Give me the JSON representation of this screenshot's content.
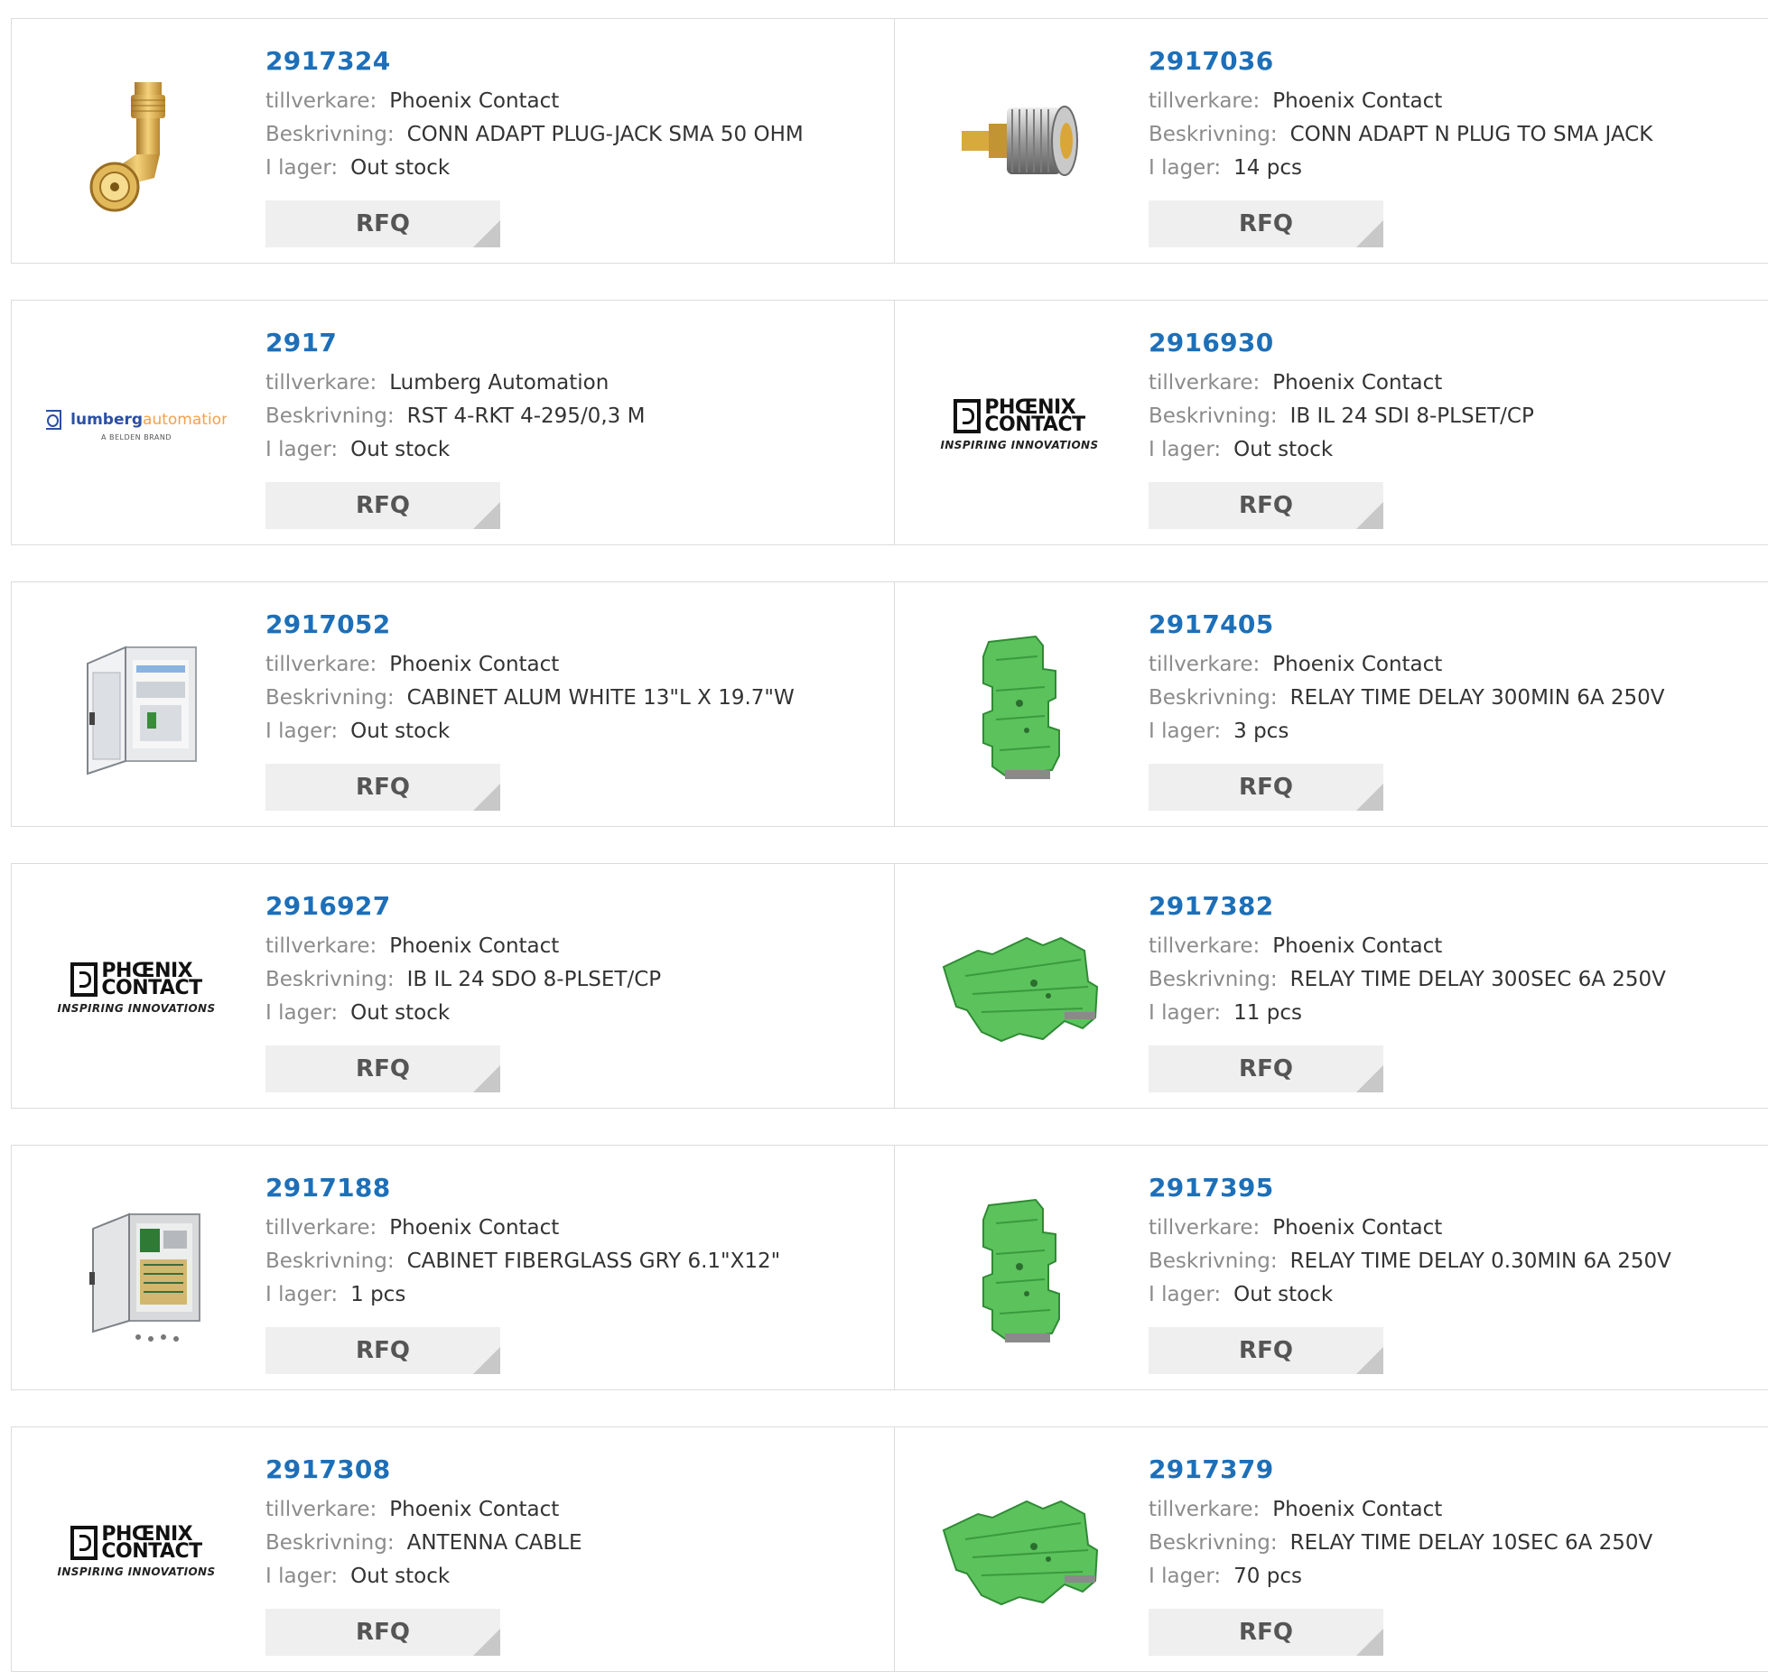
{
  "colors": {
    "part_number": "#1d6fb8",
    "label": "#8b8b8b",
    "value": "#333333",
    "button_bg": "#efefef",
    "border": "#dcdcdc"
  },
  "labels": {
    "manufacturer": "tillverkare:",
    "description": "Beskrivning:",
    "stock": "I lager:",
    "rfq": "RFQ"
  },
  "products": [
    {
      "pn": "2917324",
      "manufacturer": "Phoenix Contact",
      "description": "CONN ADAPT PLUG-JACK SMA 50 OHM",
      "stock": "Out stock",
      "image": "sma-right-angle-adapter"
    },
    {
      "pn": "2917036",
      "manufacturer": "Phoenix Contact",
      "description": "CONN ADAPT N PLUG TO SMA JACK",
      "stock": "14 pcs",
      "image": "n-to-sma-adapter"
    },
    {
      "pn": "2917",
      "manufacturer": "Lumberg Automation",
      "description": "RST 4-RKT 4-295/0,3 M",
      "stock": "Out stock",
      "image": "lumberg-logo",
      "logo": {
        "brand": "lumberg",
        "automation": "automation",
        "sub": "A BELDEN BRAND"
      }
    },
    {
      "pn": "2916930",
      "manufacturer": "Phoenix Contact",
      "description": "IB IL 24 SDI 8-PLSET/CP",
      "stock": "Out stock",
      "image": "phoenix-contact-logo",
      "logo": {
        "line1": "PHŒNIX",
        "line2": "CONTACT",
        "tag": "INSPIRING INNOVATIONS"
      }
    },
    {
      "pn": "2917052",
      "manufacturer": "Phoenix Contact",
      "description": "CABINET ALUM WHITE 13\"L X 19.7\"W",
      "stock": "Out stock",
      "image": "white-cabinet"
    },
    {
      "pn": "2917405",
      "manufacturer": "Phoenix Contact",
      "description": "RELAY TIME DELAY 300MIN 6A 250V",
      "stock": "3 pcs",
      "image": "green-relay-upright"
    },
    {
      "pn": "2916927",
      "manufacturer": "Phoenix Contact",
      "description": "IB IL 24 SDO 8-PLSET/CP",
      "stock": "Out stock",
      "image": "phoenix-contact-logo",
      "logo": {
        "line1": "PHŒNIX",
        "line2": "CONTACT",
        "tag": "INSPIRING INNOVATIONS"
      }
    },
    {
      "pn": "2917382",
      "manufacturer": "Phoenix Contact",
      "description": "RELAY TIME DELAY 300SEC 6A 250V",
      "stock": "11 pcs",
      "image": "green-relay-flat"
    },
    {
      "pn": "2917188",
      "manufacturer": "Phoenix Contact",
      "description": "CABINET FIBERGLASS GRY 6.1\"X12\"",
      "stock": "1 pcs",
      "image": "grey-cabinet"
    },
    {
      "pn": "2917395",
      "manufacturer": "Phoenix Contact",
      "description": "RELAY TIME DELAY 0.30MIN 6A 250V",
      "stock": "Out stock",
      "image": "green-relay-upright"
    },
    {
      "pn": "2917308",
      "manufacturer": "Phoenix Contact",
      "description": "ANTENNA CABLE",
      "stock": "Out stock",
      "image": "phoenix-contact-logo",
      "logo": {
        "line1": "PHŒNIX",
        "line2": "CONTACT",
        "tag": "INSPIRING INNOVATIONS"
      }
    },
    {
      "pn": "2917379",
      "manufacturer": "Phoenix Contact",
      "description": "RELAY TIME DELAY 10SEC 6A 250V",
      "stock": "70 pcs",
      "image": "green-relay-flat"
    }
  ]
}
